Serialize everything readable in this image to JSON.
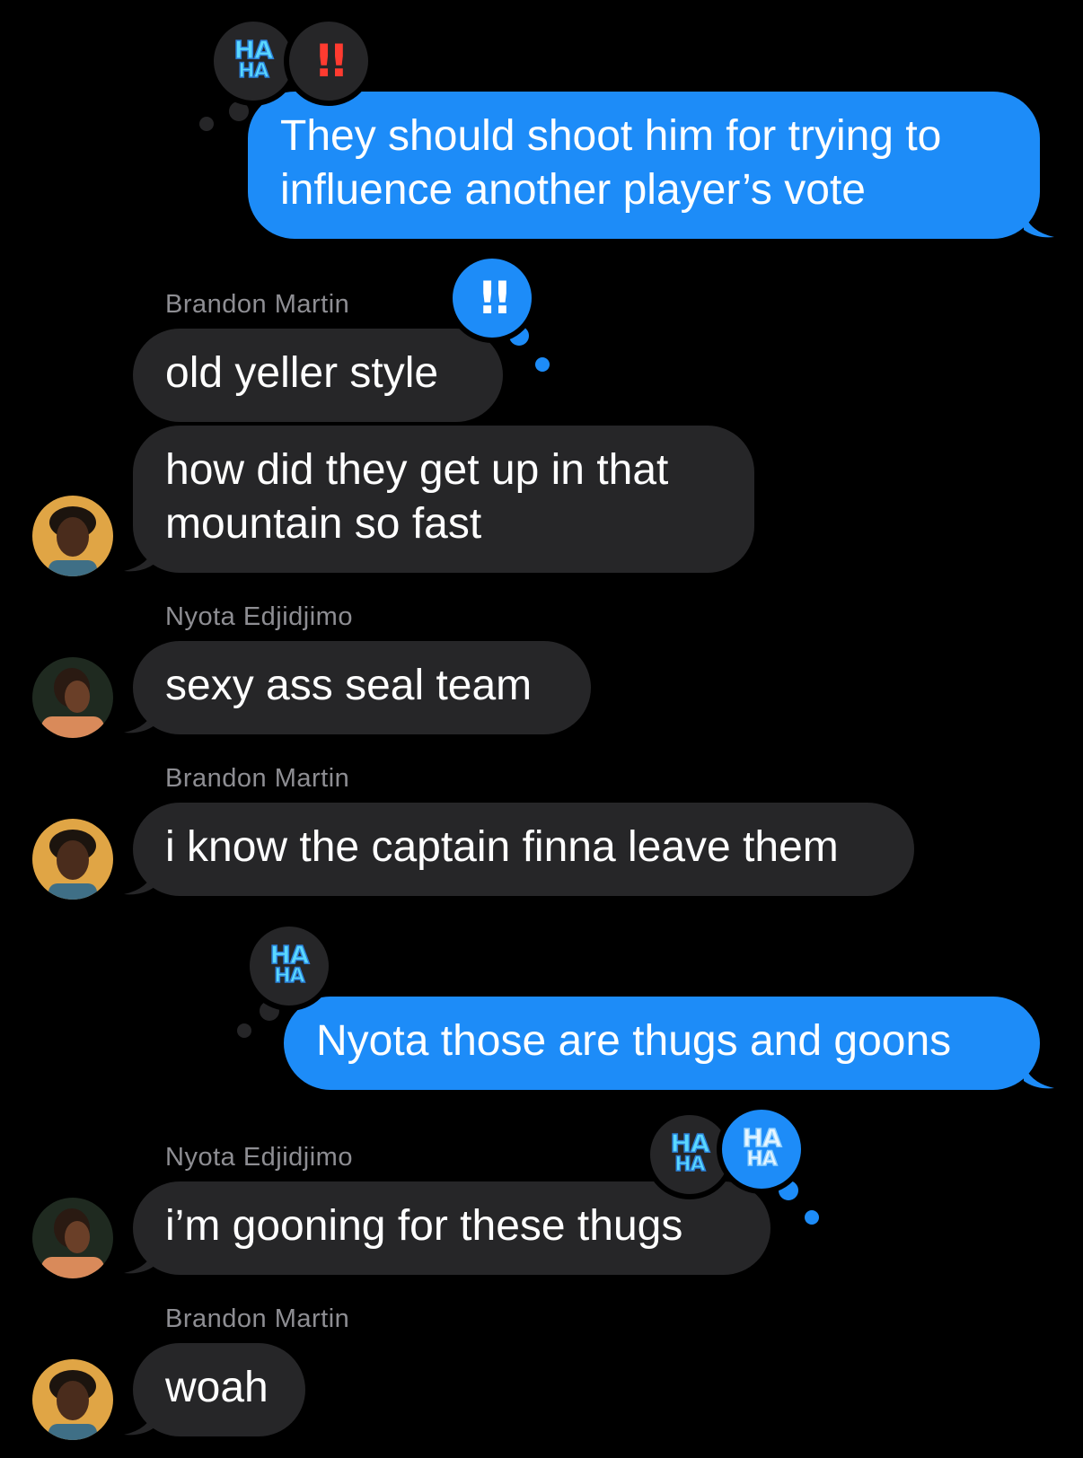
{
  "colors": {
    "outgoing": "#1d8cf8",
    "incoming": "#262628",
    "sender_name": "#8e8e93",
    "background": "#000000"
  },
  "messages": [
    {
      "direction": "outgoing",
      "text_lines": [
        "They should shoot him for trying to",
        "influence another player’s vote"
      ],
      "tapbacks": [
        "haha",
        "exclamation"
      ]
    },
    {
      "direction": "incoming",
      "sender": "Brandon Martin",
      "text": "old yeller style",
      "tapbacks": [
        "exclamation"
      ]
    },
    {
      "direction": "incoming",
      "text_lines": [
        "how did they get up in that",
        "mountain so fast"
      ]
    },
    {
      "direction": "incoming",
      "sender": "Nyota Edjidjimo",
      "text": "sexy ass seal team"
    },
    {
      "direction": "incoming",
      "sender": "Brandon Martin",
      "text": "i know the captain finna leave them"
    },
    {
      "direction": "outgoing",
      "text": "Nyota those are thugs and goons",
      "tapbacks": [
        "haha"
      ]
    },
    {
      "direction": "incoming",
      "sender": "Nyota Edjidjimo",
      "text": "i’m gooning for these thugs",
      "tapbacks": [
        "haha",
        "haha"
      ]
    },
    {
      "direction": "incoming",
      "sender": "Brandon Martin",
      "text": "woah"
    }
  ],
  "tapback": {
    "haha_line1": "HA",
    "haha_line2": "HA",
    "exclamation": "!!"
  }
}
